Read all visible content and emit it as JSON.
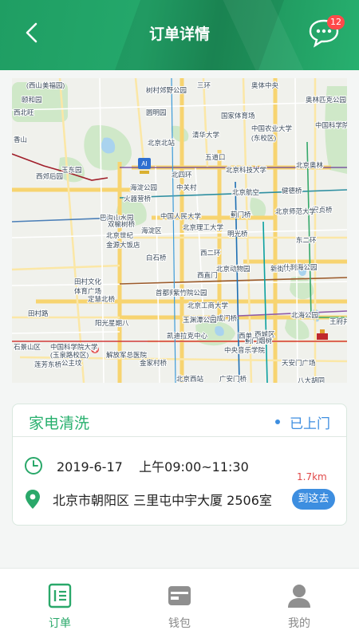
{
  "header": {
    "title": "订单详情",
    "message_count": "12",
    "back_icon": "back-arrow-icon",
    "message_icon": "chat-bubble-icon"
  },
  "map": {
    "labels": [
      "(西山美福园)",
      "颐和园",
      "树村郊野公园",
      "奥体中央",
      "奥林匹克公园",
      "国家体育场",
      "西北旺",
      "三环",
      "香山",
      "清华大学",
      "中国农业大学",
      "中国科学院",
      "(东校区)",
      "五道口",
      "圆明园",
      "玉东园",
      "西郊后园",
      "北四环",
      "中关村",
      "北京科技大学",
      "北京奥林",
      "火器营桥",
      "海淀公园",
      "北京航空",
      "健德桥",
      "安贞桥",
      "巴沟山水园",
      "中国人民大学",
      "蓟门桥",
      "北京师范大学",
      "北京理工大学",
      "海淀区",
      "明光桥",
      "北京世纪",
      "金源大饭店",
      "北京动物园",
      "新街口",
      "什刹海公园",
      "田村文化",
      "体育广场",
      "首都师范大学",
      "西直门",
      "定慧北桥",
      "北京工商大学",
      "阜成门桥",
      "北海公园",
      "田村路",
      "紫竹院公园",
      "王府井",
      "阳光星期八",
      "玉渊潭公园",
      "西城区",
      "石景山区",
      "中国科学院大学",
      "(玉泉路校区)",
      "解放军总医院",
      "中央音乐学院",
      "蓟门烟树",
      "天安门广场",
      "莲芳东桥",
      "公主坟",
      "金家村桥",
      "北京西站",
      "广安门桥",
      "八大胡同",
      "北京南站",
      "西单",
      "凯迪拉克中心",
      "北京北站",
      "双榆树桥",
      "白石桥",
      "西二环",
      "东二环"
    ],
    "center_marker_label": "AI"
  },
  "order": {
    "service_type": "家电清洗",
    "status": "已上门",
    "time": "2019-6-17    上午09:00~11:30",
    "address": "北京市朝阳区 三里屯中宇大厦 2506室",
    "distance": "1.7km",
    "navigate_label": "到这去",
    "time_icon": "clock-icon",
    "address_icon": "location-pin-icon"
  },
  "tabbar": {
    "tabs": [
      {
        "label": "订单",
        "icon": "order-list-icon",
        "active": true
      },
      {
        "label": "钱包",
        "icon": "wallet-icon",
        "active": false
      },
      {
        "label": "我的",
        "icon": "user-icon",
        "active": false
      }
    ]
  },
  "colors": {
    "brand_green": "#24a86b",
    "status_blue": "#3d8ee0",
    "distance_red": "#e04848",
    "badge_red": "#ff4a4a"
  }
}
